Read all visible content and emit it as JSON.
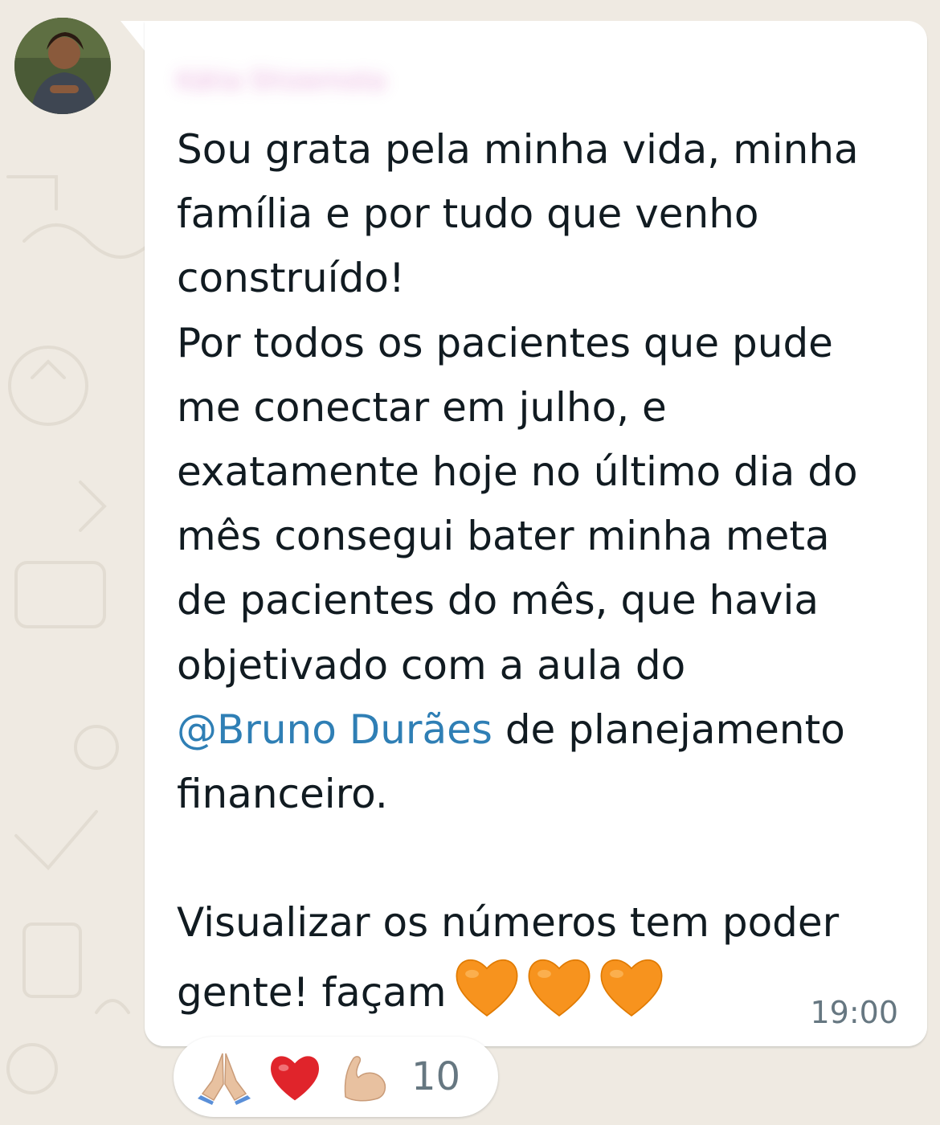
{
  "message": {
    "sender_name": "Kátia Shizemota",
    "lines": [
      "Sou grata pela minha vida, minha",
      "família e por tudo que venho",
      "construído!",
      "Por todos os pacientes que pude",
      "me conectar em julho, e",
      "exatamente hoje no último dia do",
      "mês consegui bater minha meta",
      "de pacientes do mês, que havia",
      "objetivado com a aula do"
    ],
    "mention": "@Bruno Durães",
    "after_mention": " de planejamento",
    "line_financeiro": "financeiro.",
    "line_visualizar": "Visualizar os números tem poder",
    "line_last": "gente! façam",
    "trailing_emoji": [
      "orange-heart",
      "orange-heart",
      "orange-heart"
    ],
    "time": "19:00"
  },
  "reactions": {
    "emojis": [
      "folded-hands",
      "red-heart",
      "flexed-biceps"
    ],
    "count": "10"
  },
  "colors": {
    "chat_background": "#efeae2",
    "bubble": "#ffffff",
    "mention": "#2f7fb5",
    "text": "#111b21",
    "meta": "#667781"
  }
}
